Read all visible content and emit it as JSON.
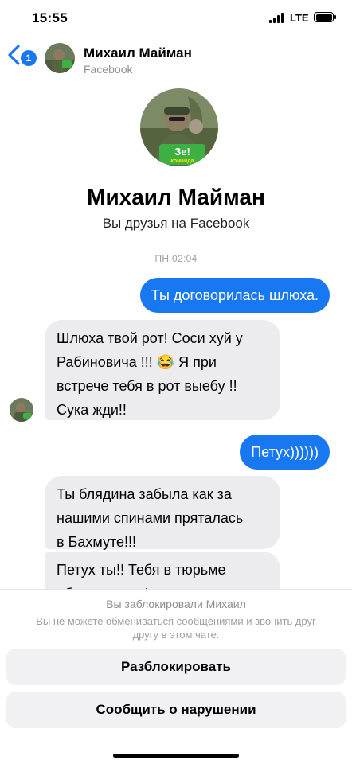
{
  "status_bar": {
    "time": "15:55",
    "network": "LTE"
  },
  "header": {
    "back_badge_count": "1",
    "name": "Михаил Майман",
    "subtitle": "Facebook"
  },
  "profile": {
    "name": "Михаил Майман",
    "relation": "Вы друзья на Facebook",
    "avatar_badge": "Зе!",
    "avatar_badge_sub": "команда"
  },
  "chat": {
    "timestamp": "ПН 02:04",
    "messages": [
      {
        "direction": "outgoing",
        "text": "Ты договорилась шлюха."
      },
      {
        "direction": "incoming",
        "lines": [
          "Шлюха твой рот! Соси хуй у",
          "Рабиновича !!! 😂 Я при",
          "встрече тебя в рот выебу !!",
          "Сука жди!!"
        ]
      },
      {
        "direction": "outgoing",
        "text": "Петух))))))"
      },
      {
        "direction": "incoming",
        "lines": [
          "Ты блядина забыла как за",
          "нашими спинами пряталась",
          "в Бахмуте!!!"
        ]
      },
      {
        "direction": "incoming",
        "lines": [
          "Петух ты!! Тебя в тюрьме",
          "ебали в жопу!"
        ]
      }
    ]
  },
  "blocked": {
    "title": "Вы заблокировали Михаил",
    "description": "Вы не можете обмениваться сообщениями и звонить друг другу в этом чате.",
    "unblock_label": "Разблокировать",
    "report_label": "Сообщить о нарушении"
  },
  "colors": {
    "accent": "#1778f2",
    "incoming_bubble": "#ececee",
    "badge_green": "#3cb043"
  },
  "icons": [
    "back-chevron-icon",
    "signal-icon",
    "battery-icon"
  ]
}
